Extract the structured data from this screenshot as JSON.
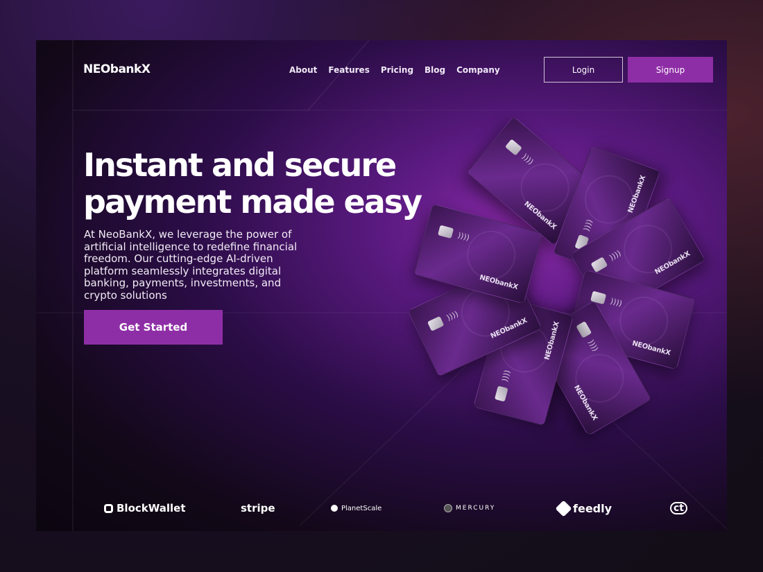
{
  "brand": {
    "logo_text": "NEObankX"
  },
  "nav": {
    "links": [
      "About",
      "Features",
      "Pricing",
      "Blog",
      "Company"
    ],
    "login_label": "Login",
    "signup_label": "Signup"
  },
  "hero": {
    "title_line1": "Instant and secure",
    "title_line2": "payment made easy",
    "description": "At NeoBankX, we leverage the power of artificial intelligence to redefine financial freedom. Our cutting-edge AI-driven platform seamlessly integrates digital banking, payments, investments, and crypto solutions",
    "cta_label": "Get Started"
  },
  "card": {
    "brand_text": "NEObankX",
    "contactless_symbol": "))))"
  },
  "partners": [
    {
      "name": "BlockWallet",
      "icon": "blockwallet-icon"
    },
    {
      "name": "stripe",
      "icon": ""
    },
    {
      "name": "PlanetScale",
      "icon": "planetscale-icon"
    },
    {
      "name": "MERCURY",
      "icon": "mercury-icon"
    },
    {
      "name": "feedly",
      "icon": "feedly-icon"
    },
    {
      "name": "ct",
      "icon": "ct-icon"
    }
  ],
  "colors": {
    "accent": "#8e2ea6",
    "background": "#120d16"
  }
}
